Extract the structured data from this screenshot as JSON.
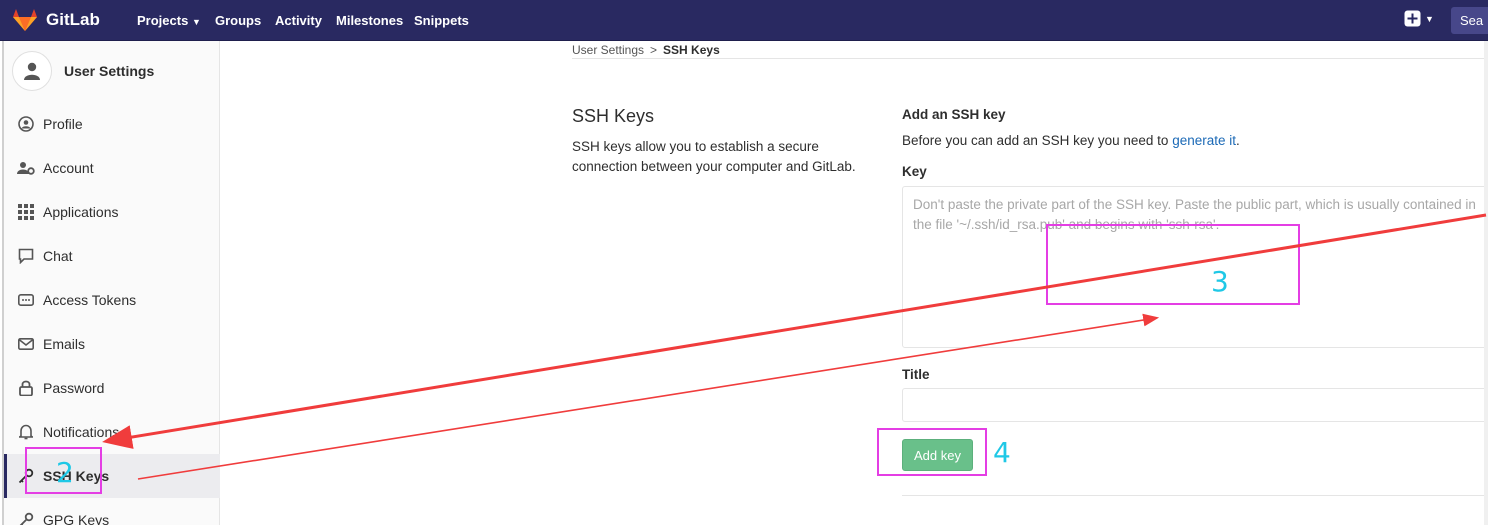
{
  "navbar": {
    "brand": "GitLab",
    "items": [
      {
        "label": "Projects",
        "has_caret": true
      },
      {
        "label": "Groups"
      },
      {
        "label": "Activity"
      },
      {
        "label": "Milestones"
      },
      {
        "label": "Snippets"
      }
    ],
    "search_label": "Sea",
    "colors": {
      "background": "#292961",
      "brand_orange": "#e2432a"
    }
  },
  "sidebar": {
    "title": "User Settings",
    "items": [
      {
        "label": "Profile",
        "icon": "profile-icon"
      },
      {
        "label": "Account",
        "icon": "account-gears-icon"
      },
      {
        "label": "Applications",
        "icon": "applications-grid-icon"
      },
      {
        "label": "Chat",
        "icon": "chat-bubble-icon"
      },
      {
        "label": "Access Tokens",
        "icon": "access-token-icon"
      },
      {
        "label": "Emails",
        "icon": "envelope-icon"
      },
      {
        "label": "Password",
        "icon": "lock-icon"
      },
      {
        "label": "Notifications",
        "icon": "bell-icon"
      },
      {
        "label": "SSH Keys",
        "icon": "key-icon",
        "active": true
      },
      {
        "label": "GPG Keys",
        "icon": "key-icon"
      }
    ]
  },
  "breadcrumb": {
    "parent": "User Settings",
    "separator": ">",
    "current": "SSH Keys"
  },
  "section": {
    "title": "SSH Keys",
    "description": "SSH keys allow you to establish a secure connection between your computer and GitLab."
  },
  "form": {
    "heading": "Add an SSH key",
    "intro": "Before you can add an SSH key you need to",
    "intro_link": "generate it",
    "intro_end": ".",
    "key_label": "Key",
    "key_placeholder": "Don't paste the private part of the SSH key. Paste the public part, which is usually contained in the file '~/.ssh/id_rsa.pub' and begins with 'ssh-rsa'.",
    "title_label": "Title",
    "title_value": "",
    "submit_label": "Add key",
    "submit_color": "#69c08a"
  },
  "annotations": {
    "color_box": "#e43ee4",
    "color_number": "#1fc8e6",
    "color_arrow": "#f03c3c",
    "labels": [
      "2",
      "3",
      "4"
    ]
  }
}
